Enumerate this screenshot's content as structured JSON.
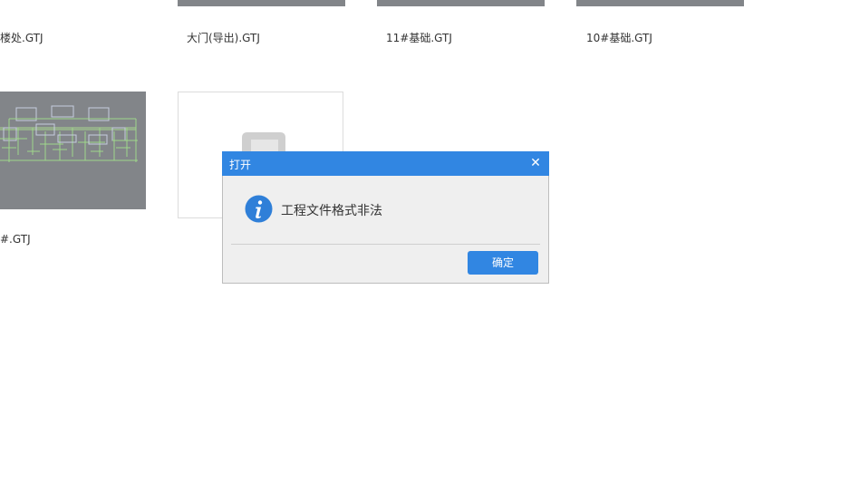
{
  "files": {
    "row1": [
      {
        "label": "楼处.GTJ"
      },
      {
        "label": "大门(导出).GTJ"
      },
      {
        "label": "11#基础.GTJ"
      },
      {
        "label": "10#基础.GTJ"
      }
    ],
    "row2": [
      {
        "label": "#.GTJ"
      }
    ]
  },
  "dialog": {
    "title": "打开",
    "close_glyph": "✕",
    "message": "工程文件格式非法",
    "ok_label": "确定",
    "icon": "info-icon"
  },
  "colors": {
    "accent": "#3186e2",
    "thumb_gray": "#828589",
    "dialog_bg": "#efefef"
  }
}
